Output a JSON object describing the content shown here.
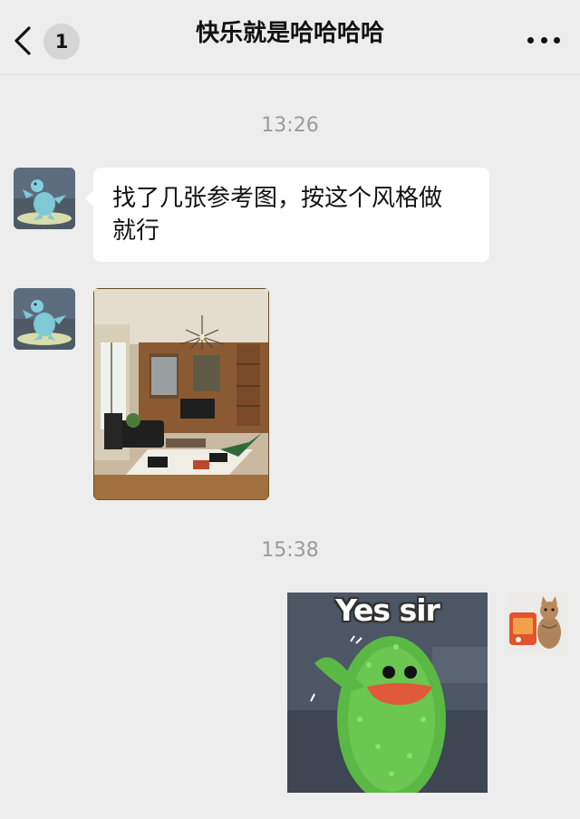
{
  "header": {
    "unread_count": "1",
    "title": "快乐就是哈哈哈哈",
    "back_icon": "chevron-left-icon",
    "more_icon": "more-dots-icon"
  },
  "messages": [
    {
      "type": "timestamp",
      "text": "13:26"
    },
    {
      "type": "text",
      "side": "left",
      "avatar": "turtle-avatar",
      "text_lines": [
        "找了几张参考图，按这个风格做",
        "就行"
      ]
    },
    {
      "type": "image",
      "side": "left",
      "avatar": "turtle-avatar",
      "content": "living-room-photo"
    },
    {
      "type": "timestamp",
      "text": "15:38"
    },
    {
      "type": "sticker",
      "side": "right",
      "avatar": "cat-avatar",
      "caption": "Yes sir"
    }
  ],
  "colors": {
    "background": "#ededed",
    "bubble": "#ffffff",
    "timestamp": "#9b9b9b"
  }
}
